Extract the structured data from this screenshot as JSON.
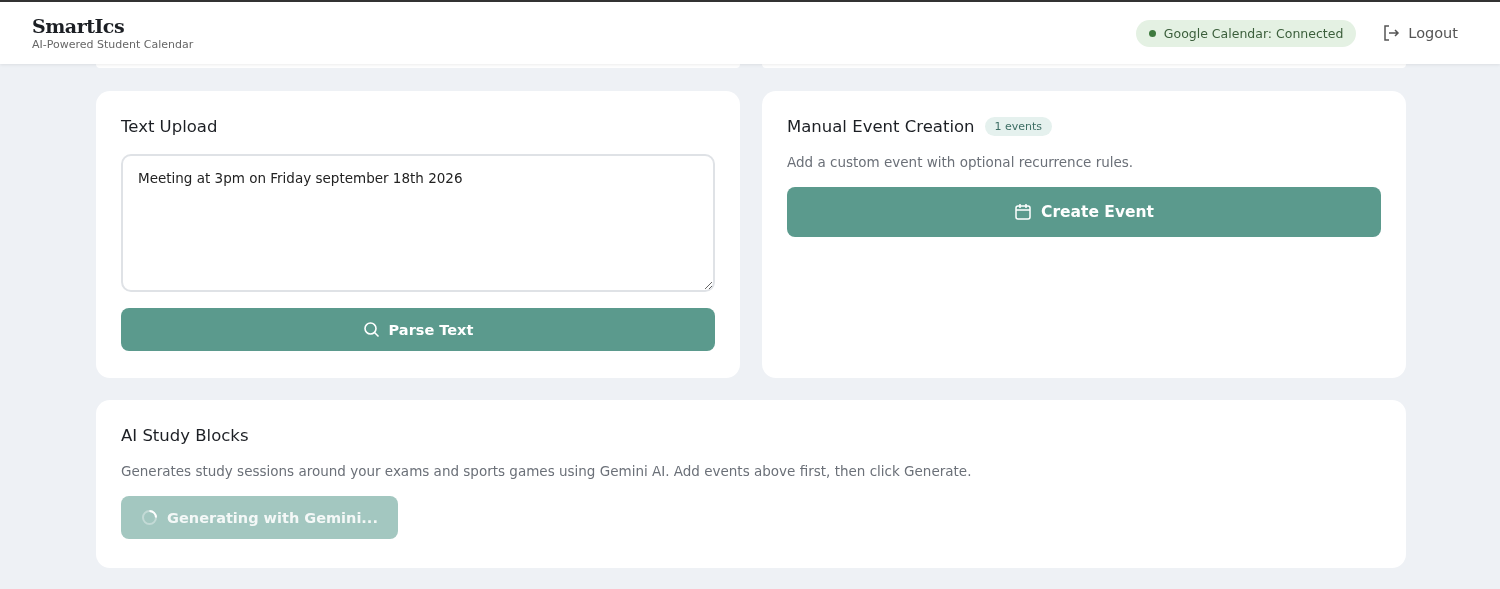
{
  "header": {
    "logo": "SmartIcs",
    "tagline": "AI-Powered Student Calendar",
    "status": {
      "label": "Google Calendar: Connected",
      "connected": true
    },
    "logout": "Logout"
  },
  "text_upload": {
    "title": "Text Upload",
    "value": "Meeting at 3pm on Friday september 18th 2026",
    "button": "Parse Text"
  },
  "manual_event": {
    "title": "Manual Event Creation",
    "badge": "1 events",
    "description": "Add a custom event with optional recurrence rules.",
    "button": "Create Event"
  },
  "study_blocks": {
    "title": "AI Study Blocks",
    "description": "Generates study sessions around your exams and sports games using Gemini AI. Add events above first, then click Generate.",
    "button": {
      "label": "Generating with Gemini...",
      "disabled": true
    }
  }
}
